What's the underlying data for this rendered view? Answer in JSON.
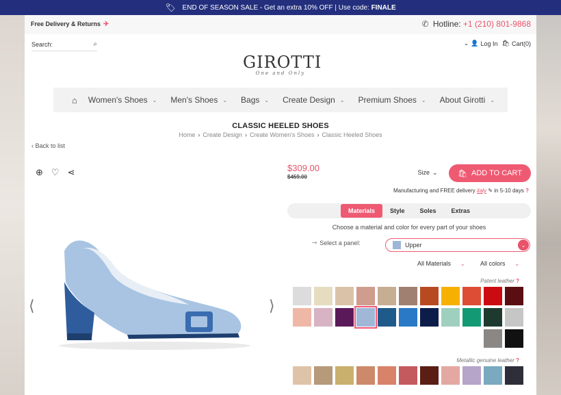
{
  "promo": {
    "text": "END OF SEASON SALE - Get an extra 10% OFF | Use code: ",
    "code": "FINALE"
  },
  "header": {
    "free_delivery": "Free Delivery & Returns",
    "hotline_label": "Hotline:",
    "hotline_number": "+1 (210) 801-9868",
    "search_label": "Search:",
    "login": "Log In",
    "cart": "Cart(0)",
    "logo": "GIROTTI",
    "logo_tagline": "One and Only"
  },
  "nav": [
    "Women's Shoes",
    "Men's Shoes",
    "Bags",
    "Create Design",
    "Premium Shoes",
    "About Girotti"
  ],
  "page_title": "CLASSIC HEELED SHOES",
  "breadcrumb": [
    "Home",
    "Create Design",
    "Create Women's Shoes",
    "Classic Heeled Shoes"
  ],
  "back": "Back to list",
  "product": {
    "price": "$309.00",
    "old_price": "$459.00",
    "size": "Size",
    "add_to_cart": "ADD TO CART",
    "manufacturing": "Manufacturing and FREE delivery",
    "flag": "italy",
    "days": "in 5-10 days"
  },
  "tabs": [
    "Materials",
    "Style",
    "Soles",
    "Extras"
  ],
  "choose_text": "Choose a material and color for every part of your shoes",
  "panel": {
    "label": "Select a panel:",
    "value": "Upper",
    "color": "#9db5d8"
  },
  "filters": {
    "materials": "All Materials",
    "colors": "All colors"
  },
  "group1": {
    "label": "Patent leather",
    "colors": [
      "#dcdcdc",
      "#e6dcc0",
      "#d9c3a8",
      "#cf9c8d",
      "#c6ae93",
      "#a08070",
      "#b84a22",
      "#f6b100",
      "#dd4d36",
      "#cc0a12",
      "#5a0e12",
      "#efb7a6",
      "#d7b3c3",
      "#5a1a5a",
      "#a0b7d8",
      "#1e5a8a",
      "#2a79c7",
      "#0c1d4a",
      "#9fcfbf",
      "#139a74",
      "#1e3a2e",
      "#c6c6c6",
      "#8a8784",
      "#111111"
    ],
    "selected": 14
  },
  "group2": {
    "label": "Metallic genuine leather",
    "colors": [
      "#dfc3a8",
      "#b69a7a",
      "#c9b06c",
      "#cc8a6a",
      "#d9826a",
      "#c55a5e",
      "#5a1e14",
      "#e4a8a2",
      "#b6a4c9",
      "#79aac0",
      "#2e2e3a"
    ]
  }
}
